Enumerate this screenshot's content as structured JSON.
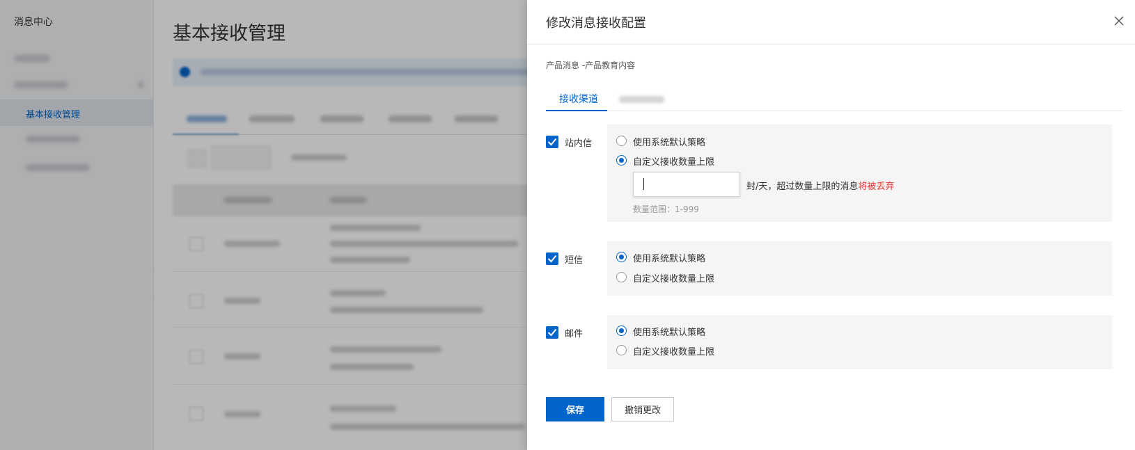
{
  "sidebar": {
    "title": "消息中心",
    "active_item": "基本接收管理",
    "collapse_icon": "chevron-left-icon"
  },
  "main": {
    "page_title": "基本接收管理"
  },
  "drawer": {
    "title": "修改消息接收配置",
    "close_icon": "close-icon",
    "subtitle": "产品消息 -产品教育内容",
    "tabs": [
      {
        "label": "接收渠道",
        "active": true
      }
    ],
    "channels": [
      {
        "name": "站内信",
        "checked": true,
        "options": [
          "使用系统默认策略",
          "自定义接收数量上限"
        ],
        "selected": 1,
        "limit": {
          "value": "",
          "suffix": "封/天，超过数量上限的消息",
          "warning": "将被丢弃",
          "range": "数量范围：1-999"
        }
      },
      {
        "name": "短信",
        "checked": true,
        "options": [
          "使用系统默认策略",
          "自定义接收数量上限"
        ],
        "selected": 0
      },
      {
        "name": "邮件",
        "checked": true,
        "options": [
          "使用系统默认策略",
          "自定义接收数量上限"
        ],
        "selected": 0
      }
    ],
    "save_label": "保存",
    "cancel_label": "撤销更改"
  },
  "colors": {
    "primary": "#0064c8",
    "warning": "#e53935",
    "panel_bg": "#f5f5f6"
  }
}
